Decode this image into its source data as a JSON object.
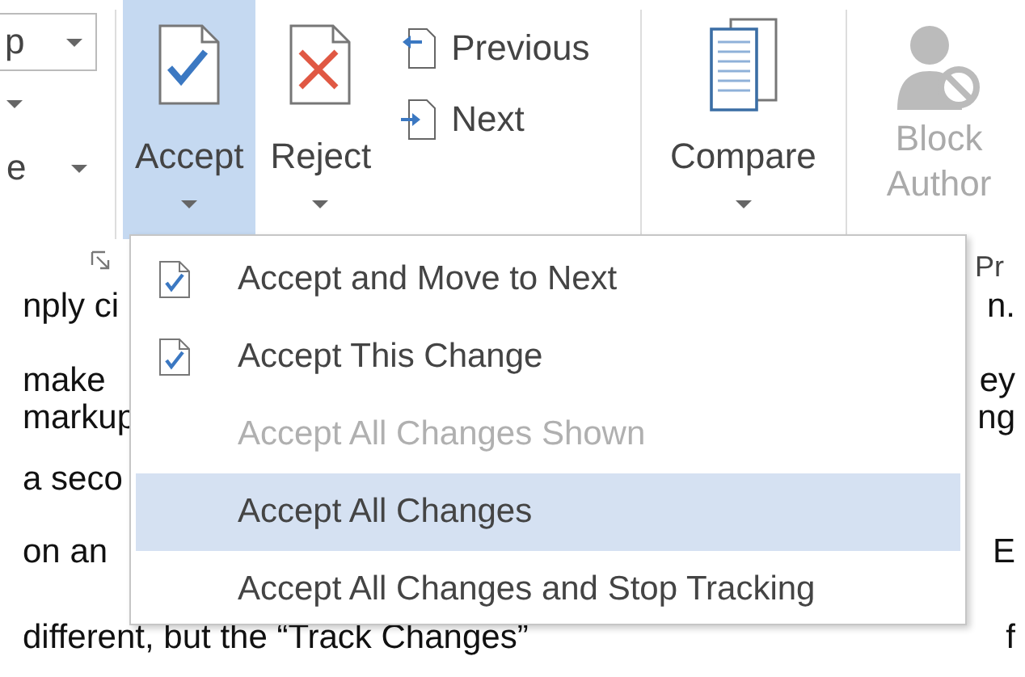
{
  "ribbon": {
    "left_controls": [
      {
        "kind": "combo",
        "text": "p"
      },
      {
        "kind": "arrow"
      },
      {
        "kind": "menu",
        "text": "e"
      }
    ],
    "review_buttons": [
      {
        "kind": "accept",
        "label": "Accept",
        "selected": true
      },
      {
        "kind": "reject",
        "label": "Reject",
        "selected": false
      }
    ],
    "nav_buttons": [
      {
        "kind": "previous",
        "label": "Previous"
      },
      {
        "kind": "next",
        "label": "Next"
      }
    ],
    "compare": {
      "label": "Compare"
    },
    "block_authors": {
      "lines": [
        "Block",
        "Author"
      ],
      "disabled": true
    },
    "side_label": "Pr"
  },
  "document": {
    "lines": [
      {
        "left": "nply ci",
        "right": "n."
      },
      {
        "left": "make",
        "right": "ey"
      },
      {
        "left": "markup",
        "right": "ng"
      },
      {
        "left": "a seco"
      },
      {
        "left": "on an",
        "right": "E"
      },
      {
        "left": "different, but the “Track Changes”",
        "right": "f"
      }
    ]
  },
  "accept_menu": {
    "items": [
      {
        "label": "Accept and Move to Next",
        "kind": "check-doc",
        "disabled": false,
        "selected": false
      },
      {
        "label": "Accept This Change",
        "kind": "check-doc",
        "disabled": false,
        "selected": false
      },
      {
        "label": "Accept All Changes Shown",
        "disabled": true,
        "selected": false
      },
      {
        "label": "Accept All Changes",
        "disabled": false,
        "selected": true
      },
      {
        "label": "Accept All Changes and Stop Tracking",
        "disabled": false,
        "selected": false
      }
    ]
  }
}
